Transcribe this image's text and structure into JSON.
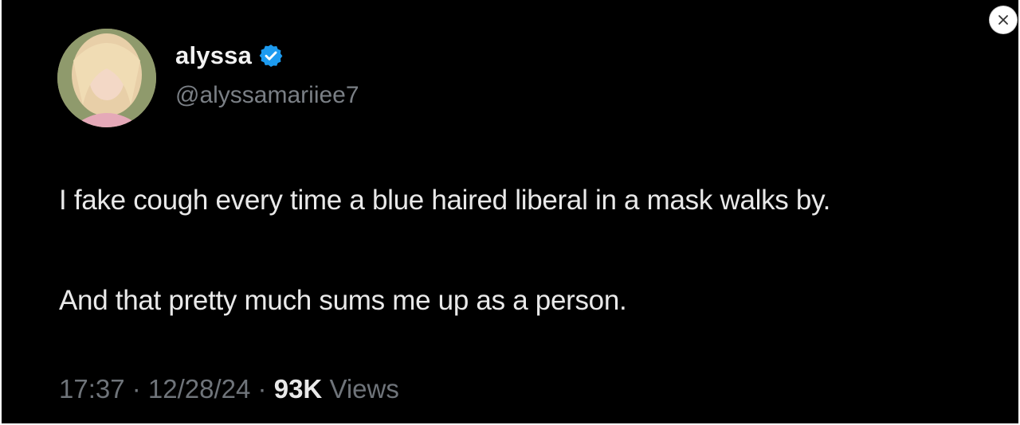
{
  "tweet": {
    "display_name": "alyssa",
    "handle": "@alyssamariiee7",
    "verified": true,
    "text_lines": [
      "I fake cough every time a blue haired liberal in a mask walks by.",
      "And that pretty much sums me up as a person."
    ],
    "time": "17:37",
    "date": "12/28/24",
    "separator": " · ",
    "views_count": "93K",
    "views_label": "Views"
  },
  "icons": {
    "verified": "verified-badge-icon",
    "close": "close-icon"
  },
  "colors": {
    "background": "#000000",
    "verified_blue": "#1d9bf0",
    "text": "#e9e9e9",
    "muted": "#6f747a"
  }
}
